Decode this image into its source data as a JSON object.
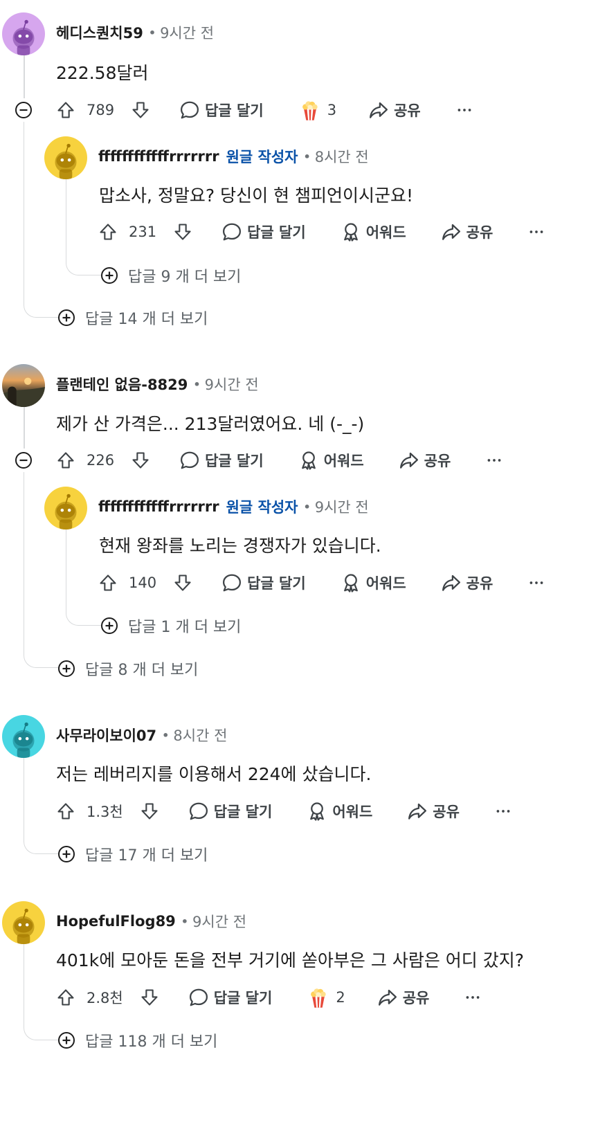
{
  "comments": [
    {
      "author": "헤디스퀀치59",
      "time": "9시간 전",
      "text": "222.58달러",
      "score": "789",
      "reply_label": "답글 달기",
      "award_count": "3",
      "share_label": "공유",
      "replies": [
        {
          "author": "ffffffffffffrrrrrrr",
          "op_tag": "원글 작성자",
          "time": "8시간 전",
          "text": "맙소사, 정말요? 당신이 현 챔피언이시군요!",
          "score": "231",
          "reply_label": "답글 달기",
          "award_label": "어워드",
          "share_label": "공유",
          "more_replies": "답글 9 개 더 보기"
        }
      ],
      "more_replies": "답글 14 개 더 보기"
    },
    {
      "author": "플랜테인 없음-8829",
      "time": "9시간 전",
      "text": "제가 산 가격은... 213달러였어요. 네 (-_-)",
      "score": "226",
      "reply_label": "답글 달기",
      "award_label": "어워드",
      "share_label": "공유",
      "replies": [
        {
          "author": "ffffffffffffrrrrrrr",
          "op_tag": "원글 작성자",
          "time": "9시간 전",
          "text": "현재 왕좌를 노리는 경쟁자가 있습니다.",
          "score": "140",
          "reply_label": "답글 달기",
          "award_label": "어워드",
          "share_label": "공유",
          "more_replies": "답글 1 개 더 보기"
        }
      ],
      "more_replies": "답글 8 개 더 보기"
    },
    {
      "author": "사무라이보이07",
      "time": "8시간 전",
      "text": "저는 레버리지를 이용해서 224에 샀습니다.",
      "score": "1.3천",
      "reply_label": "답글 달기",
      "award_label": "어워드",
      "share_label": "공유",
      "more_replies": "답글 17 개 더 보기"
    },
    {
      "author": "HopefulFlog89",
      "time": "9시간 전",
      "text": "401k에 모아둔 돈을 전부 거기에 쏟아부은 그 사람은 어디 갔지?",
      "score": "2.8천",
      "reply_label": "답글 달기",
      "award_count": "2",
      "share_label": "공유",
      "more_replies": "답글 118 개 더 보기"
    }
  ],
  "icons": {
    "upvote": "arrow-up-outline-icon",
    "downvote": "arrow-down-outline-icon",
    "comment": "speech-bubble-icon",
    "award": "award-ribbon-icon",
    "popcorn": "popcorn-icon",
    "share": "share-arrow-icon",
    "more": "ellipsis-icon",
    "collapse": "minus-circle-icon",
    "expand": "plus-circle-icon"
  },
  "colors": {
    "op_tag": "#0a52a8",
    "meta": "#6f7478",
    "thread_line": "#d8dadc"
  }
}
